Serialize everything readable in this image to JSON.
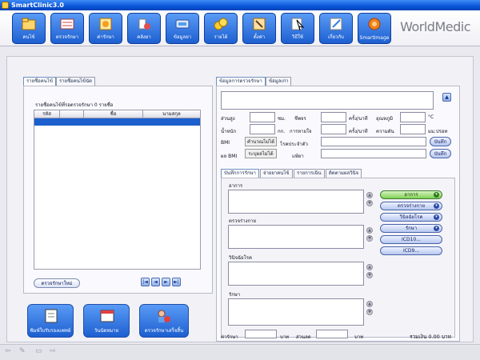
{
  "window": {
    "title": "SmartClinic3.0"
  },
  "toolbar": {
    "items": [
      {
        "label": "คนไข้",
        "icon": "folder-icon"
      },
      {
        "label": "ตรวจรักษา",
        "icon": "examination-icon"
      },
      {
        "label": "ค่ารักษา",
        "icon": "billing-icon"
      },
      {
        "label": "คลังยา",
        "icon": "pharmacy-icon"
      },
      {
        "label": "ข้อมูลยา",
        "icon": "drug-info-icon"
      },
      {
        "label": "รายได้",
        "icon": "income-icon"
      },
      {
        "label": "ตั้งค่า",
        "icon": "settings-icon"
      },
      {
        "label": "วิธีใช้",
        "icon": "help-icon"
      },
      {
        "label": "เกี่ยวกับ",
        "icon": "about-icon"
      },
      {
        "label": "SmartImage",
        "icon": "smartimage-icon"
      }
    ],
    "brand": "WorldMedic"
  },
  "left_tabs": [
    "รายชื่อคนไข้",
    "รายชื่อคนไข้นัด"
  ],
  "queue_caption": "รายชื่อคนไข้ที่รอตรวจรักษา 0 รายชื่อ",
  "patient_table": {
    "columns": [
      "รหัส",
      "",
      "ชื่อ",
      "นามสกุล"
    ]
  },
  "left_buttons": {
    "new_exam": "ตรวจรักษาใหม่"
  },
  "nav_buttons": [
    "|◄",
    "◄",
    "►",
    "►|"
  ],
  "bottom_buttons": [
    {
      "label": "พิมพ์ใบรับรองแพทย์",
      "icon": "certificate-icon"
    },
    {
      "label": "วันนัดหมาย",
      "icon": "calendar-icon"
    },
    {
      "label": "ตรวจรักษาเสร็จสิ้น",
      "icon": "finish-icon"
    }
  ],
  "right_tabs": [
    "ข้อมูลการตรวจรักษา",
    "ข้อมูลเก่า"
  ],
  "vitals": {
    "height_label": "ส่วนสูง",
    "height_unit": "ซม.",
    "pulse_label": "ชีพจร",
    "pulse_unit": "ครั้ง/นาที",
    "temp_label": "อุณหภูมิ",
    "temp_unit": "°C",
    "weight_label": "น้ำหนัก",
    "weight_unit": "กก.",
    "resp_label": "การหายใจ",
    "resp_unit": "ครั้ง/นาที",
    "bp_label": "ความดัน",
    "bp_unit": "มม.ปรอท",
    "bmi_label": "BMI",
    "bmi_button": "คำนวณไม่ได้",
    "bmi_result_label": "ผล BMI",
    "bmi_result_button": "ระบุผลไม่ได้",
    "chronic_label": "โรคประจำตัว",
    "allergy_label": "แพ้ยา",
    "save_label": "บันทึก"
  },
  "sub_tabs": [
    "บันทึกการรักษา",
    "จ่ายยาคนไข้",
    "รายการเฉิน",
    "ติดตามผลวินิจ"
  ],
  "record": {
    "symptom": "อาการ",
    "physical_exam": "ตรวจร่างกาย",
    "diagnosis": "วินิจฉัยโรค",
    "treatment": "รักษา"
  },
  "side_buttons": [
    {
      "label": "อาการ",
      "style": "green"
    },
    {
      "label": "ตรวจร่างกาย",
      "style": "blue"
    },
    {
      "label": "วินิจฉัยโรค",
      "style": "blue"
    },
    {
      "label": "รักษา",
      "style": "blue"
    },
    {
      "label": "ICD10...",
      "style": "blue"
    },
    {
      "label": "ICD9...",
      "style": "blue"
    }
  ],
  "footer": {
    "fee_label": "ค่ารักษา",
    "fee_unit": "บาท",
    "discount_label": "ส่วนลด",
    "discount_unit": "บาท",
    "total_text": "รวมเงิน 0.00 บาท"
  },
  "colors": {
    "toolbar_blue": "#1d5fd0",
    "selection": "#1d5fcc",
    "green_accent": "#7fcf55"
  }
}
